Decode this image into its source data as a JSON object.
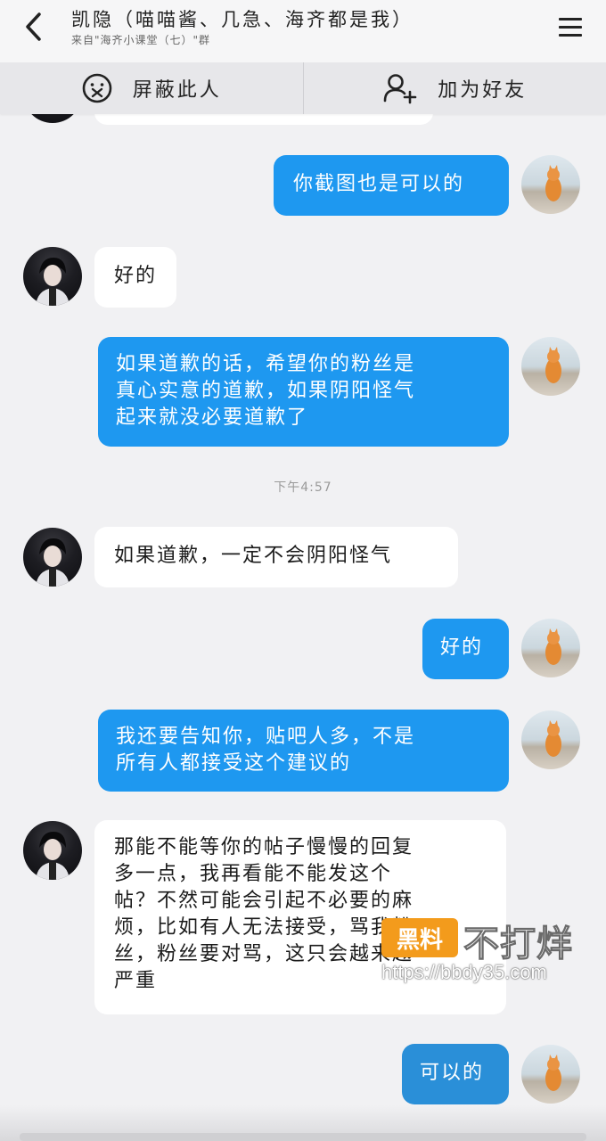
{
  "header": {
    "title": "凯隐（喵喵酱、几急、海齐都是我）",
    "subtitle": "来自\"海齐小课堂（七）\"群"
  },
  "actions": {
    "block_label": "屏蔽此人",
    "add_friend_label": "加为好友"
  },
  "messages": [
    {
      "from": "me",
      "text": "你截图也是可以的"
    },
    {
      "from": "them",
      "text": "好的"
    },
    {
      "from": "me",
      "text": "如果道歉的话，希望你的粉丝是\n真心实意的道歉，如果阴阳怪气\n起来就没必要道歉了"
    },
    {
      "from": "them",
      "text": "如果道歉，一定不会阴阳怪气"
    },
    {
      "from": "me",
      "text": "好的"
    },
    {
      "from": "me",
      "text": "我还要告知你，贴吧人多，不是\n所有人都接受这个建议的"
    },
    {
      "from": "them",
      "text": "那能不能等你的帖子慢慢的回复\n多一点，我再看能不能发这个\n帖？不然可能会引起不必要的麻\n烦，比如有人无法接受，骂我粉\n丝，粉丝要对骂，这只会越来越\n严重"
    },
    {
      "from": "me",
      "text": "可以的"
    }
  ],
  "timestamp": "下午4:57",
  "watermark": {
    "badge": "黑料",
    "name": "不打烊",
    "url": "https://bbdy35.com"
  }
}
